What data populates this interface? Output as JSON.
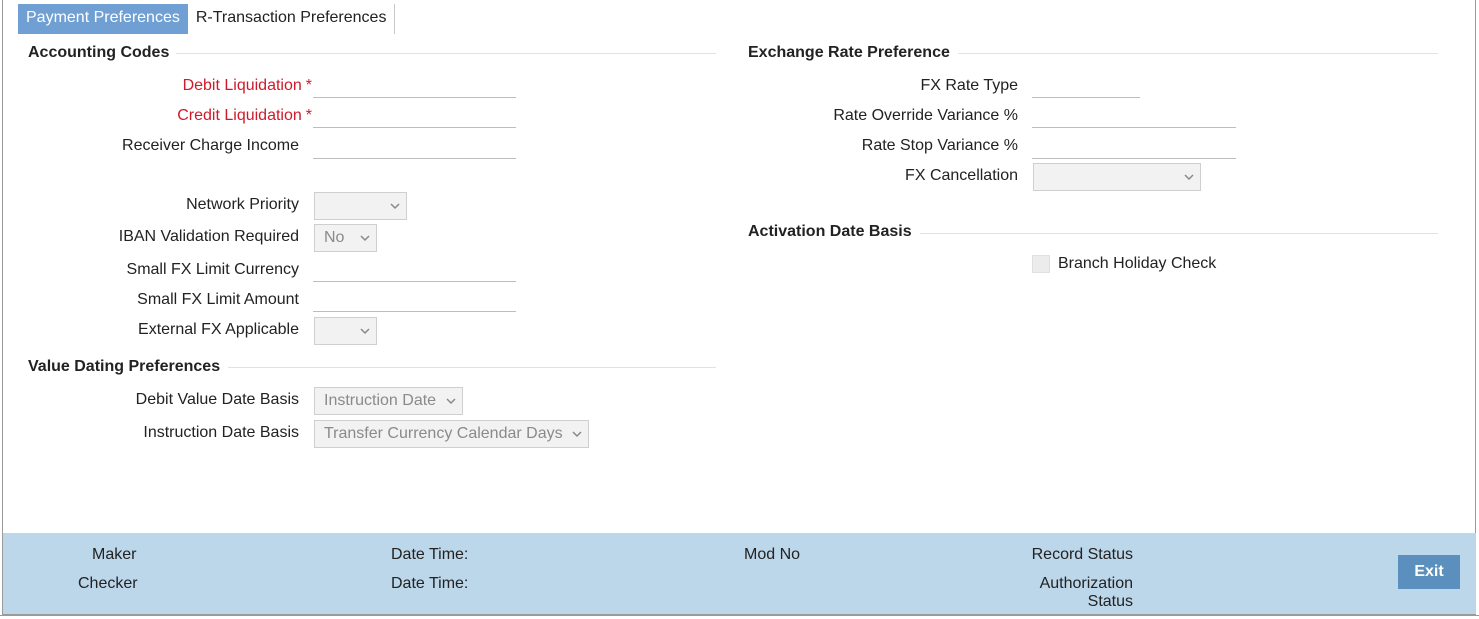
{
  "tabs": [
    {
      "label": "Payment Preferences",
      "active": true
    },
    {
      "label": "R-Transaction Preferences",
      "active": false
    }
  ],
  "accounting_codes": {
    "title": "Accounting Codes",
    "debit_liquidation": {
      "label": "Debit Liquidation",
      "required_mark": "*",
      "value": ""
    },
    "credit_liquidation": {
      "label": "Credit Liquidation",
      "required_mark": "*",
      "value": ""
    },
    "receiver_charge_income": {
      "label": "Receiver Charge Income",
      "value": ""
    },
    "network_priority": {
      "label": "Network Priority",
      "selected": ""
    },
    "iban_validation_required": {
      "label": "IBAN Validation Required",
      "selected": "No"
    },
    "small_fx_limit_currency": {
      "label": "Small FX Limit Currency",
      "value": ""
    },
    "small_fx_limit_amount": {
      "label": "Small FX Limit Amount",
      "value": ""
    },
    "external_fx_applicable": {
      "label": "External FX Applicable",
      "selected": ""
    }
  },
  "value_dating": {
    "title": "Value Dating Preferences",
    "debit_value_date_basis": {
      "label": "Debit Value Date Basis",
      "selected": "Instruction Date"
    },
    "instruction_date_basis": {
      "label": "Instruction Date Basis",
      "selected": "Transfer Currency Calendar Days"
    }
  },
  "exchange_rate": {
    "title": "Exchange Rate Preference",
    "fx_rate_type": {
      "label": "FX Rate Type",
      "value": ""
    },
    "rate_override_variance": {
      "label": "Rate Override Variance %",
      "value": ""
    },
    "rate_stop_variance": {
      "label": "Rate Stop Variance %",
      "value": ""
    },
    "fx_cancellation": {
      "label": "FX Cancellation",
      "selected": ""
    }
  },
  "activation_date": {
    "title": "Activation Date Basis",
    "branch_holiday_check": {
      "label": "Branch Holiday Check",
      "checked": false
    }
  },
  "footer": {
    "maker": "Maker",
    "checker": "Checker",
    "date_time_1": "Date Time:",
    "date_time_2": "Date Time:",
    "mod_no": "Mod No",
    "record_status": "Record Status",
    "authorization_status_line1": "Authorization",
    "authorization_status_line2": "Status",
    "exit_label": "Exit"
  },
  "colors": {
    "active_tab": "#6f9fd3",
    "required_label": "#d0192a",
    "footer_bg": "#bcd6ea",
    "exit_button": "#5b8fbe"
  },
  "icons": {
    "select_arrow": "chevron-down-icon"
  }
}
